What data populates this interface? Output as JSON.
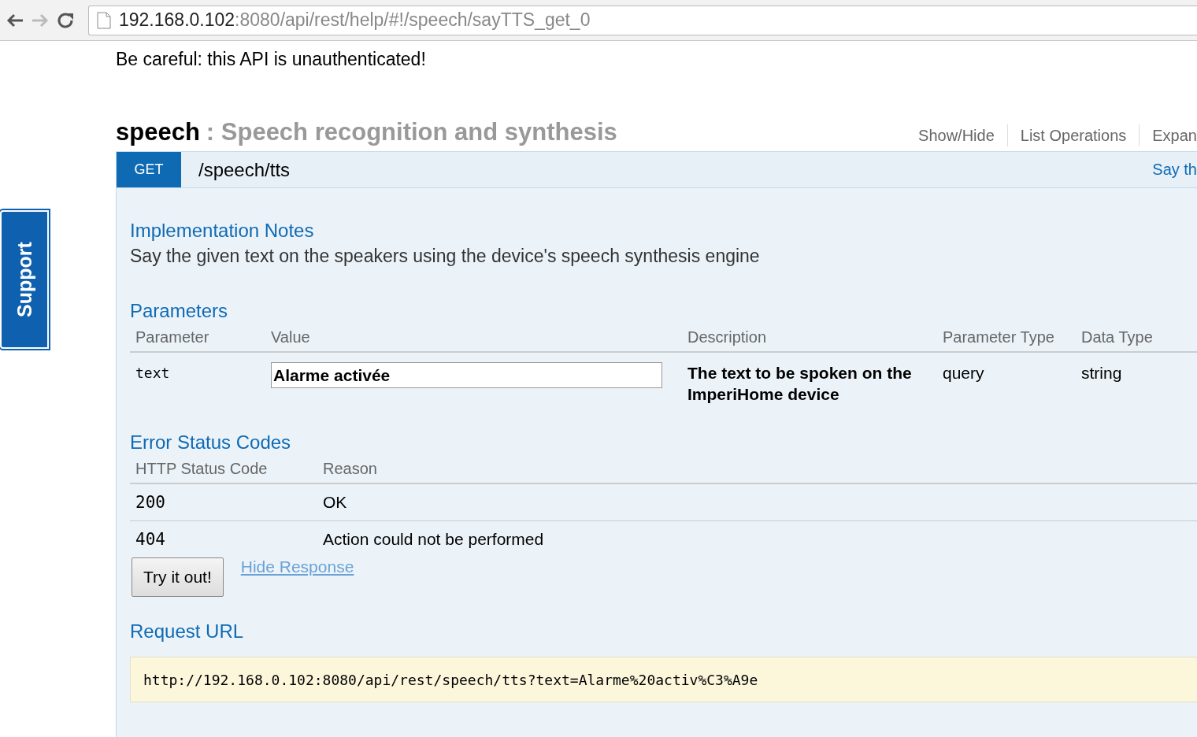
{
  "browser": {
    "url_host": "192.168.0.102",
    "url_path": ":8080/api/rest/help/#!/speech/sayTTS_get_0"
  },
  "support_tab": "Support",
  "warning": "Be careful: this API is unauthenticated!",
  "resource": {
    "name": "speech",
    "description": ": Speech recognition and synthesis",
    "links": [
      "Show/Hide",
      "List Operations",
      "Expan"
    ]
  },
  "operation": {
    "method": "GET",
    "path": "/speech/tts",
    "summary": "Say th",
    "implementation_notes": {
      "title": "Implementation Notes",
      "text": "Say the given text on the speakers using the device's speech synthesis engine"
    },
    "parameters": {
      "title": "Parameters",
      "columns": [
        "Parameter",
        "Value",
        "Description",
        "Parameter Type",
        "Data Type"
      ],
      "rows": [
        {
          "name": "text",
          "value": "Alarme activée",
          "description": "The text to be spoken on the ImperiHome device",
          "parameter_type": "query",
          "data_type": "string"
        }
      ]
    },
    "error_status_codes": {
      "title": "Error Status Codes",
      "columns": [
        "HTTP Status Code",
        "Reason"
      ],
      "rows": [
        {
          "code": "200",
          "reason": "OK"
        },
        {
          "code": "404",
          "reason": "Action could not be performed"
        }
      ]
    },
    "try_button": "Try it out!",
    "hide_response_link": "Hide Response",
    "request_url": {
      "title": "Request URL",
      "value": "http://192.168.0.102:8080/api/rest/speech/tts?text=Alarme%20activ%C3%A9e"
    }
  }
}
